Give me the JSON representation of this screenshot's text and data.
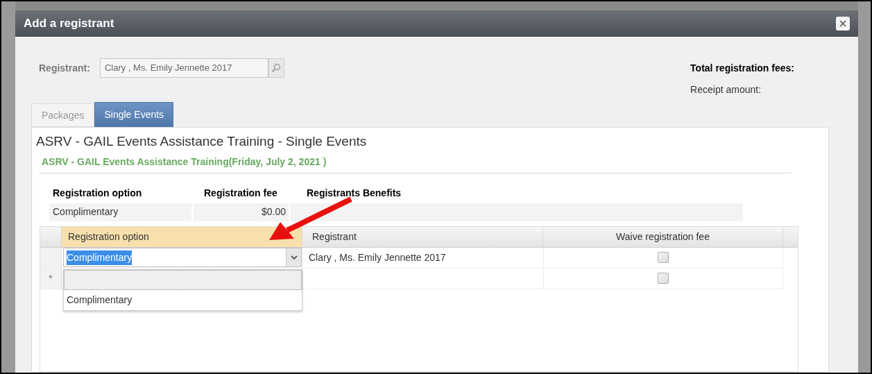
{
  "dialog": {
    "title": "Add a registrant"
  },
  "registrant": {
    "label": "Registrant:",
    "value": "Clary , Ms. Emily Jennette 2017"
  },
  "totals": {
    "fees_label": "Total registration fees:",
    "receipt_label": "Receipt amount:"
  },
  "tabs": [
    {
      "label": "Packages",
      "selected": false
    },
    {
      "label": "Single Events",
      "selected": true
    }
  ],
  "event": {
    "title": "ASRV - GAIL Events Assistance Training - Single Events",
    "subtitle": "ASRV - GAIL Events Assistance Training(Friday, July 2, 2021 )"
  },
  "options_table": {
    "columns": [
      "Registration option",
      "Registration fee",
      "Registrants Benefits"
    ],
    "rows": [
      {
        "option": "Complimentary",
        "fee": "$0.00"
      }
    ]
  },
  "grid": {
    "columns": [
      {
        "label": "Registration option",
        "active": true
      },
      {
        "label": "Registrant",
        "active": false
      },
      {
        "label": "Waive registration fee",
        "active": false
      }
    ],
    "rows": [
      {
        "option": "Complimentary",
        "registrant": "Clary , Ms. Emily Jennette 2017",
        "waive": false
      },
      {
        "marker": "*",
        "waive": false
      }
    ],
    "dropdown": {
      "open": true,
      "text_selected": true,
      "options": [
        {
          "focused": true
        },
        {
          "label": "Complimentary",
          "focused": false
        }
      ]
    }
  }
}
